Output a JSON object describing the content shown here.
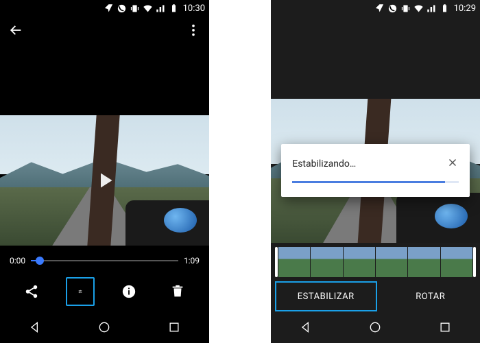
{
  "left": {
    "status": {
      "time": "10:30"
    },
    "playback": {
      "current": "0:00",
      "duration": "1:09",
      "progress_pct": 6
    }
  },
  "right": {
    "status": {
      "time": "10:29"
    },
    "dialog": {
      "title": "Estabilizando…",
      "progress_pct": 92
    },
    "tabs": {
      "stabilize": "ESTABILIZAR",
      "rotate": "ROTAR"
    }
  }
}
